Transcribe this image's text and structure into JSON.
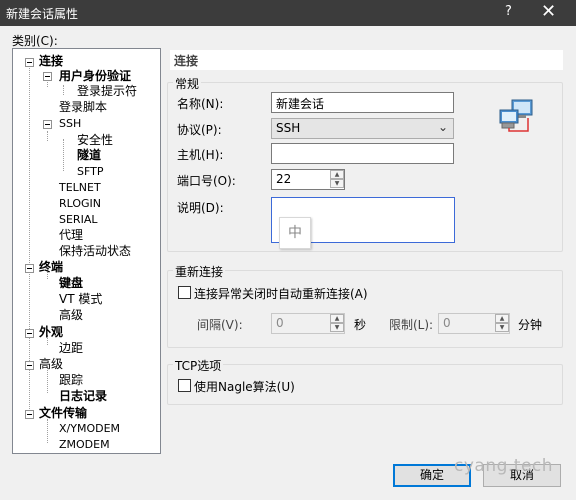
{
  "window": {
    "title": "新建会话属性",
    "help_glyph": "?",
    "close_glyph": "✕"
  },
  "category_label": "类别(C):",
  "tree": {
    "connection": "连接",
    "user_auth": "用户身份验证",
    "login_prompt": "登录提示符",
    "login_script": "登录脚本",
    "ssh": "SSH",
    "security": "安全性",
    "tunnel": "隧道",
    "sftp": "SFTP",
    "telnet": "TELNET",
    "rlogin": "RLOGIN",
    "serial": "SERIAL",
    "proxy": "代理",
    "keepalive": "保持活动状态",
    "terminal": "终端",
    "keyboard": "键盘",
    "vt_mode": "VT 模式",
    "advanced_term": "高级",
    "appearance": "外观",
    "margin": "边距",
    "advanced": "高级",
    "trace": "跟踪",
    "logging": "日志记录",
    "file_transfer": "文件传输",
    "xymodem": "X/YMODEM",
    "zmodem": "ZMODEM"
  },
  "section_title": "连接",
  "general": {
    "title": "常规",
    "name_label": "名称(N):",
    "name_value": "新建会话",
    "protocol_label": "协议(P):",
    "protocol_value": "SSH",
    "host_label": "主机(H):",
    "host_value": "",
    "port_label": "端口号(O):",
    "port_value": "22",
    "desc_label": "说明(D):",
    "desc_value": "",
    "ime_char": "中"
  },
  "reconnect": {
    "title": "重新连接",
    "auto_label": "连接异常关闭时自动重新连接(A)",
    "interval_label": "间隔(V):",
    "interval_value": "0",
    "seconds": "秒",
    "limit_label": "限制(L):",
    "limit_value": "0",
    "minutes": "分钟"
  },
  "tcp": {
    "title": "TCP选项",
    "nagle_label": "使用Nagle算法(U)"
  },
  "buttons": {
    "ok": "确定",
    "cancel": "取消"
  },
  "watermark": "cyang.tech",
  "colors": {
    "titlebar": "#3c3c3c",
    "accent": "#0078d7"
  }
}
